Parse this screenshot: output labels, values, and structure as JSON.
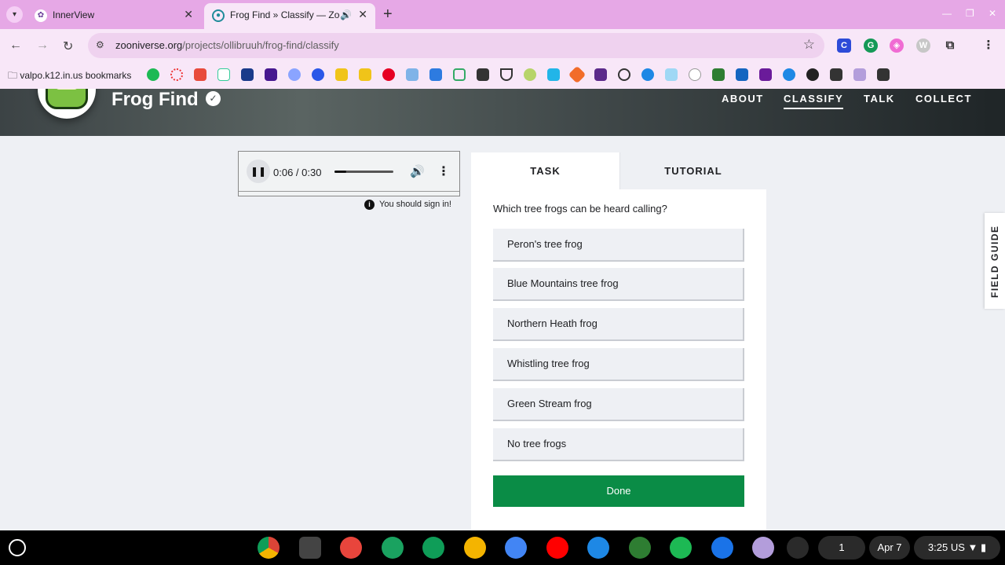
{
  "browser": {
    "tabs": [
      {
        "title": "InnerView",
        "icon": "innerview-icon"
      },
      {
        "title": "Frog Find » Classify — Zoo",
        "icon": "zooniverse-icon"
      }
    ],
    "url_host": "zooniverse.org",
    "url_path": "/projects/ollibruuh/frog-find/classify",
    "bookmarks_label": "valpo.k12.in.us bookmarks"
  },
  "project": {
    "title": "Frog Find",
    "nav": [
      "ABOUT",
      "CLASSIFY",
      "TALK",
      "COLLECT"
    ],
    "active_nav": "CLASSIFY"
  },
  "audio": {
    "time": "0:06 / 0:30",
    "progress": 0.2,
    "signin_note": "You should sign in!"
  },
  "task": {
    "tabs": [
      "TASK",
      "TUTORIAL"
    ],
    "question": "Which tree frogs can be heard calling?",
    "answers": [
      "Peron's tree frog",
      "Blue Mountains tree frog",
      "Northern Heath frog",
      "Whistling tree frog",
      "Green Stream frog",
      "No tree frogs"
    ],
    "done_label": "Done"
  },
  "field_guide_label": "FIELD GUIDE",
  "shelf": {
    "date": "Apr 7",
    "time": "3:25",
    "locale": "US",
    "notification_count": "1"
  },
  "colors": {
    "tabstrip": "#e6a8e6",
    "toolbar": "#f8e7f8",
    "done_green": "#0a8c46",
    "page_bg": "#eef0f4"
  }
}
